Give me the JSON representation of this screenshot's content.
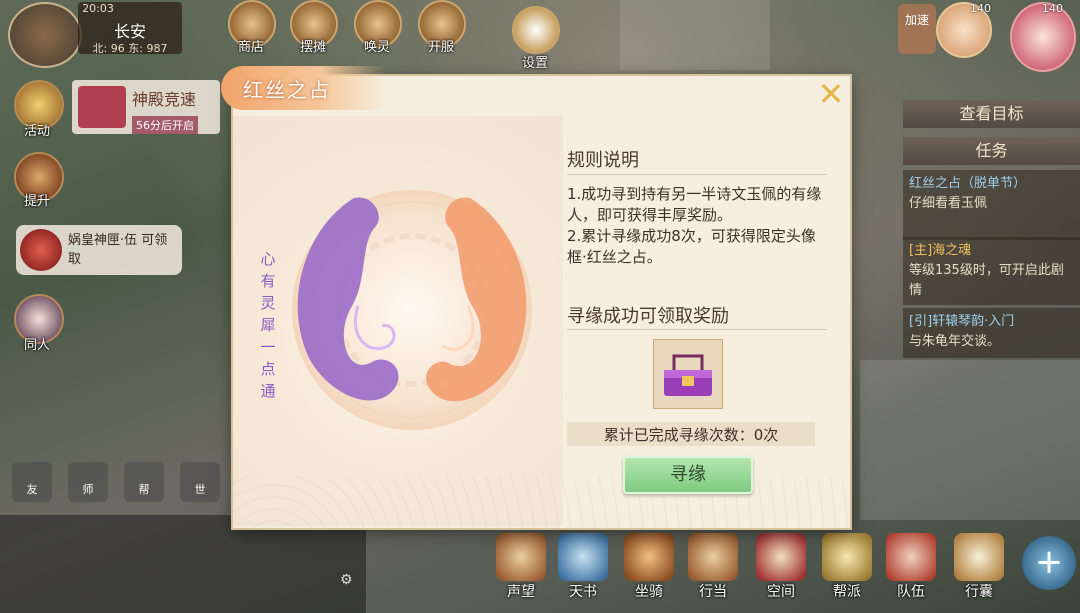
{
  "hud": {
    "time": "20:03",
    "location": "长安",
    "coords": "北: 96  东: 987",
    "top_icons": [
      "商店",
      "摆摊",
      "唤灵",
      "开服",
      "设置"
    ],
    "side_icons": [
      "活动",
      "提升",
      "同人"
    ],
    "event_banner": {
      "title": "神殿竞速",
      "subtitle": "56分后开启"
    },
    "chest_banner": {
      "text": "娲皇神匣·伍 可领取"
    },
    "chat_buttons": [
      "友",
      "师",
      "帮",
      "世"
    ],
    "bottom_icons": [
      "声望",
      "天书",
      "坐骑",
      "行当",
      "空间",
      "帮派",
      "队伍",
      "行囊"
    ],
    "top_right_label": "加速",
    "badges": [
      "140",
      "140"
    ]
  },
  "task_panel": {
    "view_target": "查看目标",
    "tasks_label": "任务",
    "items": [
      {
        "title": "红丝之占（脱单节）",
        "desc": "仔细看看玉佩"
      },
      {
        "title": "[主]海之魂",
        "desc": "等级135级时，可开启此剧情"
      },
      {
        "title": "[引]轩辕琴韵·入门",
        "desc": "与朱龟年交谈。"
      }
    ]
  },
  "dialog": {
    "title": "红丝之占",
    "close": "✕",
    "vertical_text": "心有灵犀一点通",
    "rules_title": "规则说明",
    "rule_1": "1.成功寻到持有另一半诗文玉佩的有缘人，即可获得丰厚奖励。",
    "rule_2": "2.累计寻缘成功8次，可获得限定头像框·红丝之占。",
    "reward_title": "寻缘成功可领取奖励",
    "count_text": "累计已完成寻缘次数：0次",
    "seek_button": "寻缘"
  },
  "colors": {
    "dialog_bg": "#f6efe0",
    "title_tab": "#f2a36a",
    "seek_button": "#7ac97e",
    "emblem_left": "#8a5ac4",
    "emblem_right": "#f19a68"
  }
}
